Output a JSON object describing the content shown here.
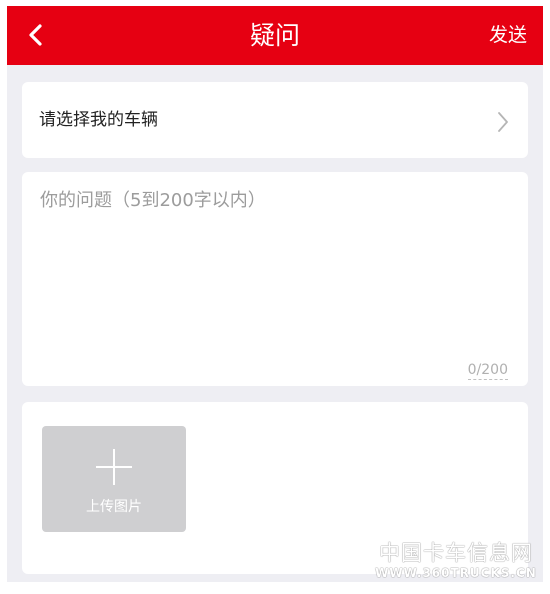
{
  "header": {
    "title": "疑问",
    "send_label": "发送",
    "back_icon": "chevron-left-icon",
    "background_color": "#e60012"
  },
  "vehicle_select": {
    "label": "请选择我的车辆",
    "icon": "chevron-right-icon"
  },
  "question": {
    "placeholder": "你的问题（5到200字以内）",
    "value": "",
    "counter": "0/200"
  },
  "upload": {
    "label": "上传图片",
    "icon": "plus-icon"
  },
  "watermark": {
    "cn": "中国卡车信息网",
    "en": "WWW.360TRUCKS.CN"
  }
}
